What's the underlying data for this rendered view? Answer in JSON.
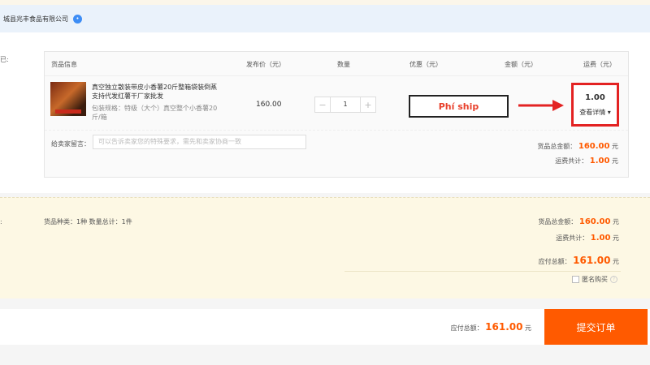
{
  "seller": {
    "name": "城县兆丰食品有限公司",
    "chat_icon": "chat-bubble-icon",
    "chat_glyph": "•"
  },
  "side_labels": {
    "goods": "已:",
    "summary": ":"
  },
  "columns": [
    "货品信息",
    "发布价（元）",
    "数量",
    "优惠（元）",
    "金额（元）",
    "运费（元）"
  ],
  "item": {
    "title": "真空独立散装带皮小香薯20斤整箱袋装倒蒸支持代发红薯干厂家批发",
    "spec": "包装规格：特级（大个）真空整个小香薯20斤/箱",
    "price": "160.00",
    "qty_minus": "−",
    "qty": "1",
    "qty_plus": "+"
  },
  "annotation": {
    "label": "Phí ship",
    "arrow_color": "#e32222"
  },
  "freight": {
    "value": "1.00",
    "detail": "查看详情",
    "caret": "▾"
  },
  "message": {
    "label": "给卖家留言：",
    "placeholder": "可以告诉卖家您的特殊要求，需先和卖家协商一致"
  },
  "card_summary": {
    "goods_total_label": "货品总金额：",
    "goods_total": "160.00",
    "freight_label": "运费共计：",
    "freight_total": "1.00",
    "unit": "元"
  },
  "order_summary": {
    "kinds": "货品种类：1种  数量总计：1件",
    "goods_total_label": "货品总金额：",
    "goods_total": "160.00",
    "freight_label": "运费共计：",
    "freight_total": "1.00",
    "payable_label": "应付总额：",
    "payable": "161.00",
    "unit": "元",
    "anonymous": "匿名购买",
    "help_glyph": "?"
  },
  "footer": {
    "total_label": "应付总额：",
    "total": "161.00",
    "unit": "元",
    "submit": "提交订单"
  },
  "colors": {
    "accent": "#ff5a00",
    "highlight": "#e32222",
    "seller_bar": "#eaf2fb",
    "summary_bg": "#fdf8e4"
  }
}
